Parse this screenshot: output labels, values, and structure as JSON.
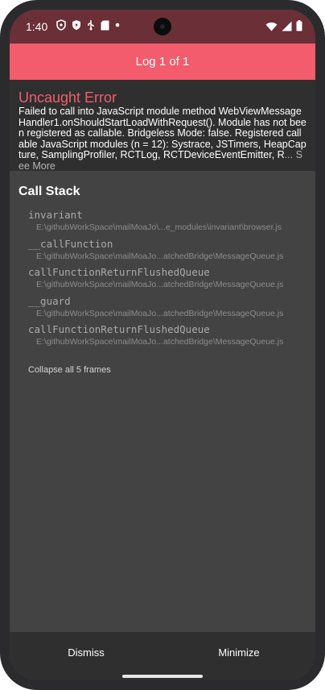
{
  "status_bar": {
    "time": "1:40",
    "icons_left": [
      "vpn-shield-icon",
      "shield-play-icon",
      "usb-debug-icon",
      "sd-card-icon",
      "dot-icon"
    ],
    "icons_right": [
      "wifi-icon",
      "cellular-signal-icon",
      "battery-icon"
    ]
  },
  "header": {
    "title": "Log 1 of 1"
  },
  "error": {
    "title": "Uncaught Error",
    "message": "Failed to call into JavaScript module method WebViewMessageHandler1.onShouldStartLoadWithRequest(). Module has not been registered as callable. Bridgeless Mode: false. Registered callable JavaScript modules (n = 12): Systrace, JSTimers, HeapCapture, SamplingProfiler, RCTLog, RCTDeviceEventEmitter, R",
    "ellipsis": "...",
    "see_more": " See More"
  },
  "callstack": {
    "title": "Call Stack",
    "frames": [
      {
        "name": "invariant",
        "path": "E:\\githubWorkSpace\\mailMoaJo\\...e_modules\\invariant\\browser.js"
      },
      {
        "name": "__callFunction",
        "path": "E:\\githubWorkSpace\\mailMoaJo...atchedBridge\\MessageQueue.js"
      },
      {
        "name": "callFunctionReturnFlushedQueue",
        "path": "E:\\githubWorkSpace\\mailMoaJo...atchedBridge\\MessageQueue.js"
      },
      {
        "name": "__guard",
        "path": "E:\\githubWorkSpace\\mailMoaJo...atchedBridge\\MessageQueue.js"
      },
      {
        "name": "callFunctionReturnFlushedQueue",
        "path": "E:\\githubWorkSpace\\mailMoaJo...atchedBridge\\MessageQueue.js"
      }
    ],
    "collapse_label": "Collapse all 5 frames"
  },
  "footer": {
    "dismiss_label": "Dismiss",
    "minimize_label": "Minimize"
  },
  "colors": {
    "accent": "#f25c6c",
    "status_bar": "#6a2f37",
    "panel_dark": "#2f2f2f",
    "panel": "#434343"
  }
}
